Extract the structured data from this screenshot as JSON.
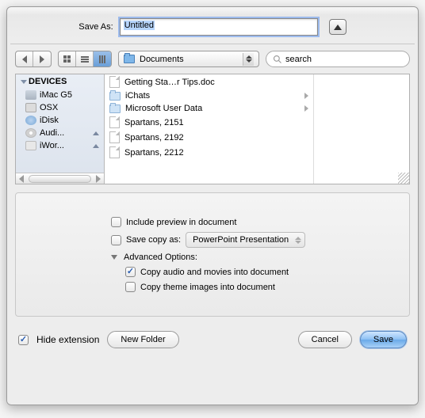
{
  "saveas": {
    "label": "Save As:",
    "value": "Untitled"
  },
  "path": {
    "label": "Documents"
  },
  "search": {
    "placeholder": "search"
  },
  "sidebar": {
    "header": "DEVICES",
    "items": [
      {
        "label": "iMac G5"
      },
      {
        "label": "OSX"
      },
      {
        "label": "iDisk"
      },
      {
        "label": "Audi...",
        "eject": true
      },
      {
        "label": "iWor...",
        "eject": true
      }
    ]
  },
  "files": [
    {
      "name": "Getting Sta…r Tips.doc",
      "type": "doc"
    },
    {
      "name": "iChats",
      "type": "folder"
    },
    {
      "name": "Microsoft User Data",
      "type": "folder"
    },
    {
      "name": "Spartans, 2151",
      "type": "doc"
    },
    {
      "name": "Spartans, 2192",
      "type": "doc"
    },
    {
      "name": "Spartans, 2212",
      "type": "doc"
    }
  ],
  "options": {
    "include_preview": "Include preview in document",
    "save_copy_as": "Save copy as:",
    "copy_format": "PowerPoint Presentation",
    "advanced": "Advanced Options:",
    "copy_av": "Copy audio and movies into document",
    "copy_theme": "Copy theme images into document"
  },
  "footer": {
    "hide_ext": "Hide extension",
    "new_folder": "New Folder",
    "cancel": "Cancel",
    "save": "Save"
  }
}
